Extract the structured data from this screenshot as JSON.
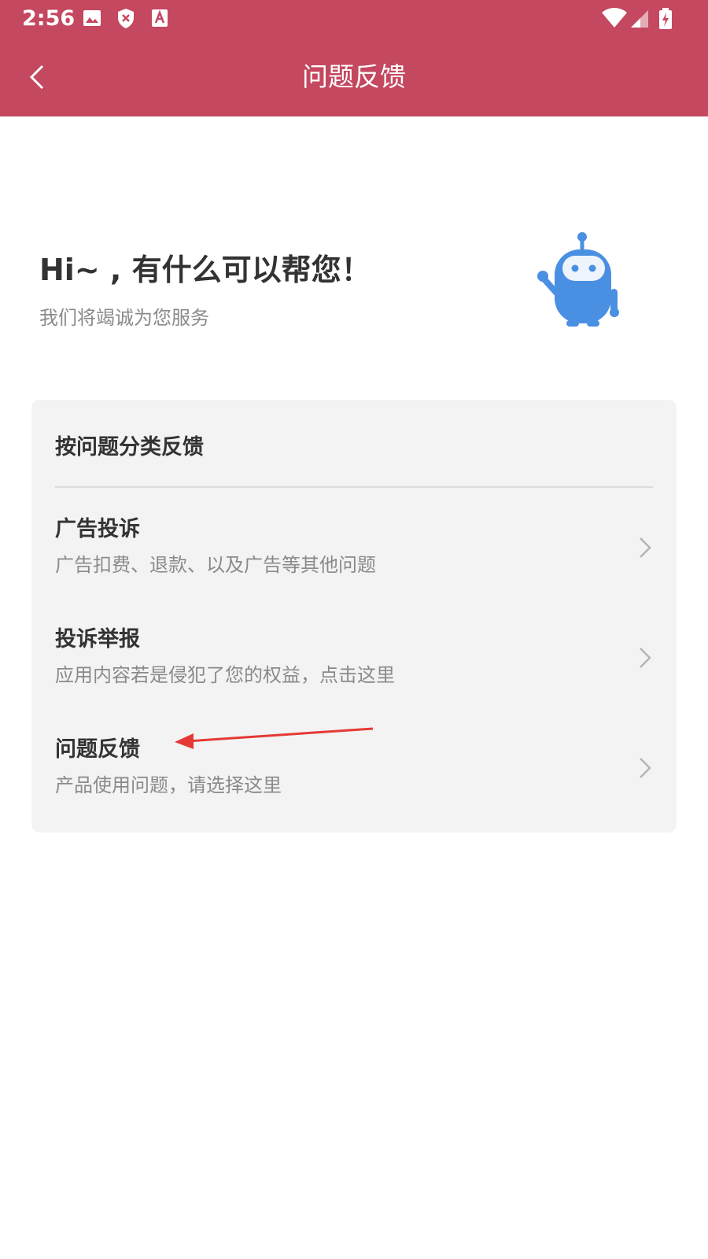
{
  "status_bar": {
    "time": "2:56",
    "left_icons": [
      "image-icon",
      "shield-x-icon",
      "text-icon"
    ],
    "right_icons": [
      "wifi-icon",
      "signal-icon",
      "battery-charging-icon"
    ]
  },
  "app_bar": {
    "title": "问题反馈",
    "back_icon": "back-arrow-icon",
    "background": "#c4485f"
  },
  "header": {
    "greeting": "Hi~ , 有什么可以帮您！",
    "subtitle": "我们将竭诚为您服务",
    "mascot_icon": "robot-icon",
    "mascot_color": "#4a90e2"
  },
  "feedback_card": {
    "section_title": "按问题分类反馈",
    "items": [
      {
        "title": "广告投诉",
        "description": "广告扣费、退款、以及广告等其他问题"
      },
      {
        "title": "投诉举报",
        "description": "应用内容若是侵犯了您的权益，点击这里"
      },
      {
        "title": "问题反馈",
        "description": "产品使用问题，请选择这里"
      }
    ]
  },
  "annotation": {
    "arrow_color": "#e53935"
  }
}
